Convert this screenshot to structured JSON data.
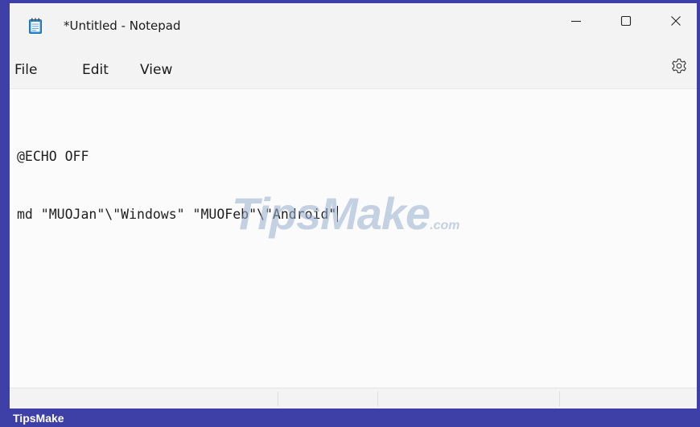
{
  "window": {
    "title": "*Untitled - Notepad",
    "app_icon": "notepad-icon"
  },
  "window_controls": {
    "minimize_icon": "minimize-icon",
    "maximize_icon": "maximize-icon",
    "close_icon": "close-icon"
  },
  "menu": {
    "items": [
      {
        "label": "File"
      },
      {
        "label": "Edit"
      },
      {
        "label": "View"
      }
    ],
    "settings_icon": "gear-icon"
  },
  "editor": {
    "lines": [
      "@ECHO OFF",
      "md \"MUOJan\"\\\"Windows\" \"MUOFeb\"\\\"Android\""
    ]
  },
  "watermark": {
    "text": "TipsMake",
    "suffix": ".com"
  },
  "banner": {
    "text": "TipsMake"
  },
  "colors": {
    "frame": "#3f3fa8",
    "chrome": "#f3f3f3",
    "editor_bg": "#fbfbfb",
    "icon_blue": "#2b7cd3"
  }
}
